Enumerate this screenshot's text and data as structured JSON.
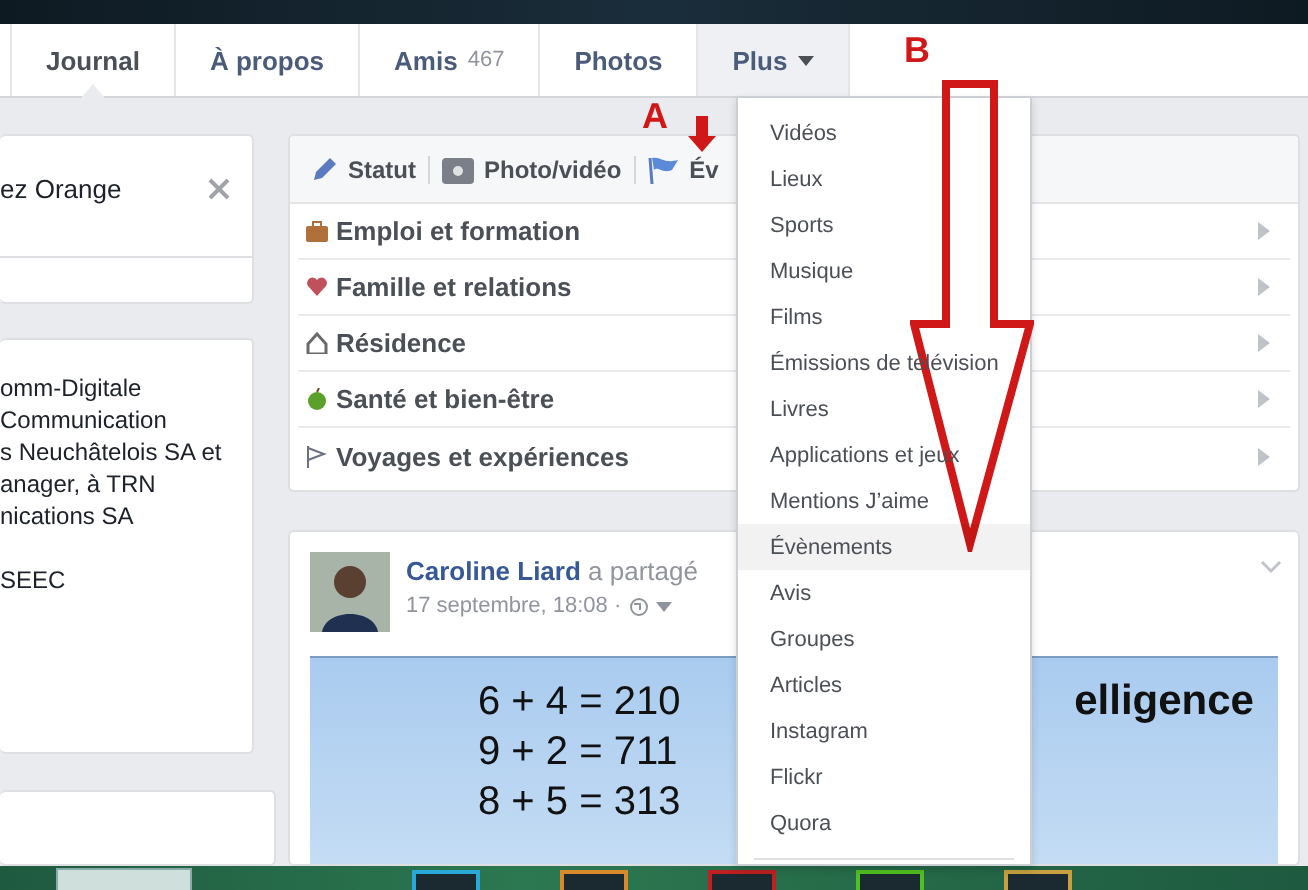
{
  "tabs": [
    {
      "label": "Journal",
      "selected": true
    },
    {
      "label": "À propos",
      "selected": false
    },
    {
      "label": "Amis",
      "count": "467",
      "selected": false
    },
    {
      "label": "Photos",
      "selected": false
    },
    {
      "label": "Plus",
      "selected": false,
      "expanded": true
    }
  ],
  "left_column": {
    "notice": "ez Orange",
    "intro_lines": [
      "omm-Digitale",
      " Communication",
      "s Neuchâtelois SA et",
      "anager, à TRN",
      "nications SA"
    ],
    "footer_line": "SEEC"
  },
  "composer": {
    "actions": [
      {
        "kind": "status",
        "label": "Statut"
      },
      {
        "kind": "photo",
        "label": "Photo/vidéo"
      },
      {
        "kind": "event",
        "label": "Év"
      }
    ],
    "life_events": [
      {
        "kind": "work",
        "label": "Emploi et formation"
      },
      {
        "kind": "family",
        "label": "Famille et relations"
      },
      {
        "kind": "home",
        "label": "Résidence"
      },
      {
        "kind": "health",
        "label": "Santé et bien-être"
      },
      {
        "kind": "travel",
        "label": "Voyages et expériences"
      }
    ]
  },
  "post": {
    "author": "Caroline Liard",
    "action": "a partagé",
    "time": "17 septembre, 18:08 ·",
    "image_lines": [
      "6 + 4 = 210",
      "9 + 2 = 711",
      "8 + 5 = 313"
    ],
    "image_side_text": "elligence"
  },
  "menu": {
    "items": [
      {
        "label": "Vidéos",
        "selected": false
      },
      {
        "label": "Lieux",
        "selected": false
      },
      {
        "label": "Sports",
        "selected": false
      },
      {
        "label": "Musique",
        "selected": false
      },
      {
        "label": "Films",
        "selected": false
      },
      {
        "label": "Émissions de télévision",
        "selected": false
      },
      {
        "label": "Livres",
        "selected": false
      },
      {
        "label": "Applications et jeux",
        "selected": false
      },
      {
        "label": "Mentions J’aime",
        "selected": false
      },
      {
        "label": "Évènements",
        "selected": true
      },
      {
        "label": "Avis",
        "selected": false
      },
      {
        "label": "Groupes",
        "selected": false
      },
      {
        "label": "Articles",
        "selected": false
      },
      {
        "label": "Instagram",
        "selected": false
      },
      {
        "label": "Flickr",
        "selected": false
      },
      {
        "label": "Quora",
        "selected": false
      }
    ]
  },
  "annotations": [
    {
      "kind": "label",
      "label": "A"
    },
    {
      "kind": "label",
      "label": "B"
    }
  ]
}
